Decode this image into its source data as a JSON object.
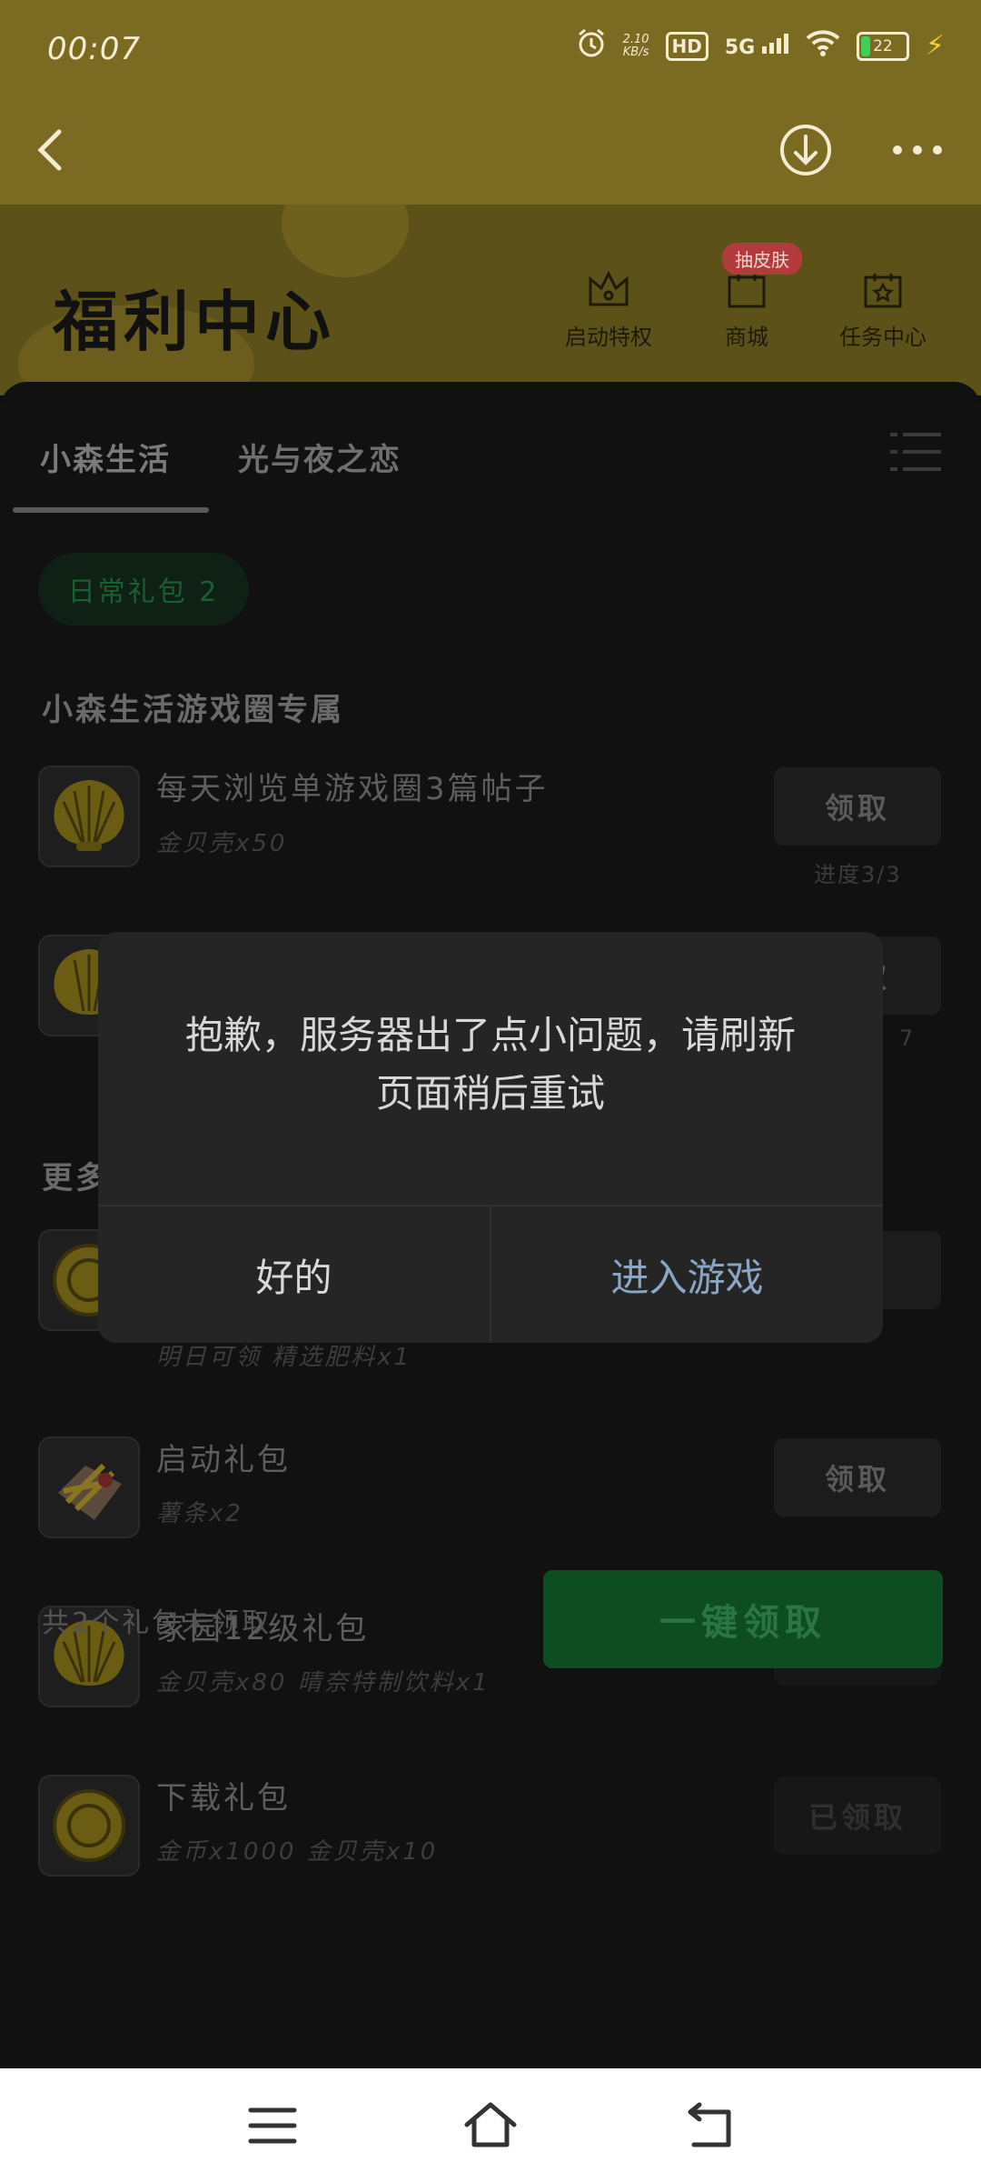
{
  "status_bar": {
    "time": "00:07",
    "net_speed_value": "2.10",
    "net_speed_unit": "KB/s",
    "hd": "HD",
    "network": "5G",
    "battery": "22"
  },
  "banner": {
    "title": "福利中心",
    "quick_links": [
      {
        "label": "启动特权",
        "icon": "crown-icon"
      },
      {
        "label": "商城",
        "icon": "shop-icon",
        "badge": "抽皮肤"
      },
      {
        "label": "任务中心",
        "icon": "task-star-icon"
      }
    ]
  },
  "tabs": [
    {
      "label": "小森生活",
      "active": true
    },
    {
      "label": "光与夜之恋",
      "active": false
    }
  ],
  "chip": {
    "label": "日常礼包 2"
  },
  "section_exclusive": {
    "title": "小森生活游戏圈专属",
    "rows": [
      {
        "title": "每天浏览单游戏圈3篇帖子",
        "sub": "金贝壳x50",
        "button": "领取",
        "progress": "进度3/3",
        "icon": "shell-icon"
      },
      {
        "icon": "shell-icon",
        "button": "领取",
        "progress_partial": "7"
      }
    ]
  },
  "section_more": {
    "title_partial": "更多",
    "rows": [
      {
        "sub": "明日可领 精选肥料x1",
        "icon": "coin-icon",
        "button_partial": "取"
      },
      {
        "title": "启动礼包",
        "sub": "薯条x2",
        "button": "领取",
        "icon": "fries-icon"
      },
      {
        "title": "家园12级礼包",
        "sub": "金贝壳x80 晴奈特制饮料x1",
        "button": "已领取",
        "icon": "shell-icon"
      },
      {
        "title": "下载礼包",
        "sub": "金币x1000 金贝壳x10",
        "button": "已领取",
        "icon": "coin-icon"
      }
    ]
  },
  "footer": {
    "unclaimed_text": "共2个礼包未领取",
    "claim_all": "一键领取"
  },
  "dialog": {
    "message_line1": "抱歉，服务器出了点小问题，请刷新",
    "message_line2": "页面稍后重试",
    "ok": "好的",
    "enter_game": "进入游戏"
  },
  "colors": {
    "header_bg": "#7a6a22",
    "dialog_bg": "#252525",
    "accent_blue": "#8aa6c4",
    "claim_green": "#0e4d22"
  }
}
